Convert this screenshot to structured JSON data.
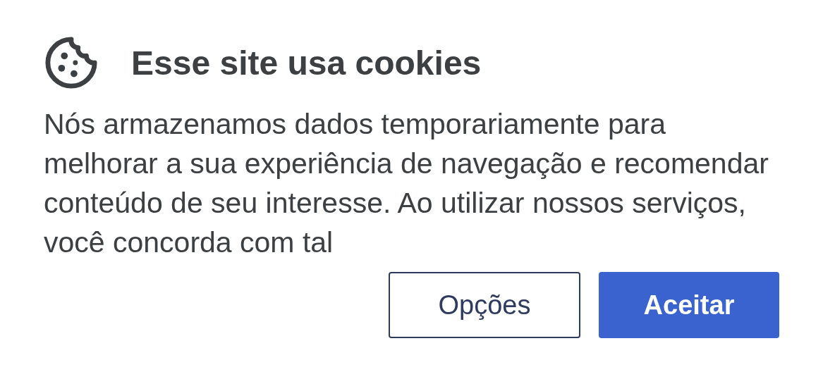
{
  "dialog": {
    "title": "Esse site usa cookies",
    "message": "Nós armazenamos dados temporariamente para melhorar a sua experiência de navegação e recomendar conteúdo de seu interesse. Ao utilizar nossos serviços, você concorda com tal",
    "buttons": [
      {
        "label": "Opções",
        "kind": "secondary"
      },
      {
        "label": "Aceitar",
        "kind": "primary"
      }
    ]
  }
}
